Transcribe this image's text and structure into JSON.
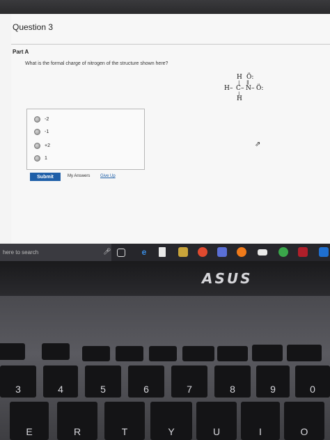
{
  "question": {
    "title": "Question 3",
    "part": "Part A",
    "prompt": "What is the formal charge of nitrogen of the structure shown here?"
  },
  "structure": {
    "top_h": "H",
    "top_o": "Ö:",
    "double_bond": "∥",
    "left_h": "H",
    "bond_dash": "–",
    "carbon": "C",
    "nitrogen": "N",
    "right_o": "Ö:",
    "bottom_h": "H",
    "vbond": "|"
  },
  "choices": [
    "-2",
    "-1",
    "+2",
    "1"
  ],
  "actions": {
    "submit": "Submit",
    "my_answers": "My Answers",
    "give_up": "Give Up"
  },
  "taskbar": {
    "search_placeholder": "here to search"
  },
  "laptop": {
    "logo": "ASUS",
    "number_keys": [
      "3",
      "4",
      "5",
      "6",
      "7",
      "8",
      "9",
      "0"
    ],
    "letter_keys": [
      "E",
      "R",
      "T",
      "Y",
      "U",
      "I",
      "O"
    ]
  },
  "colors": {
    "accent": "#1f5fa8",
    "taskbar": "#26262b"
  }
}
